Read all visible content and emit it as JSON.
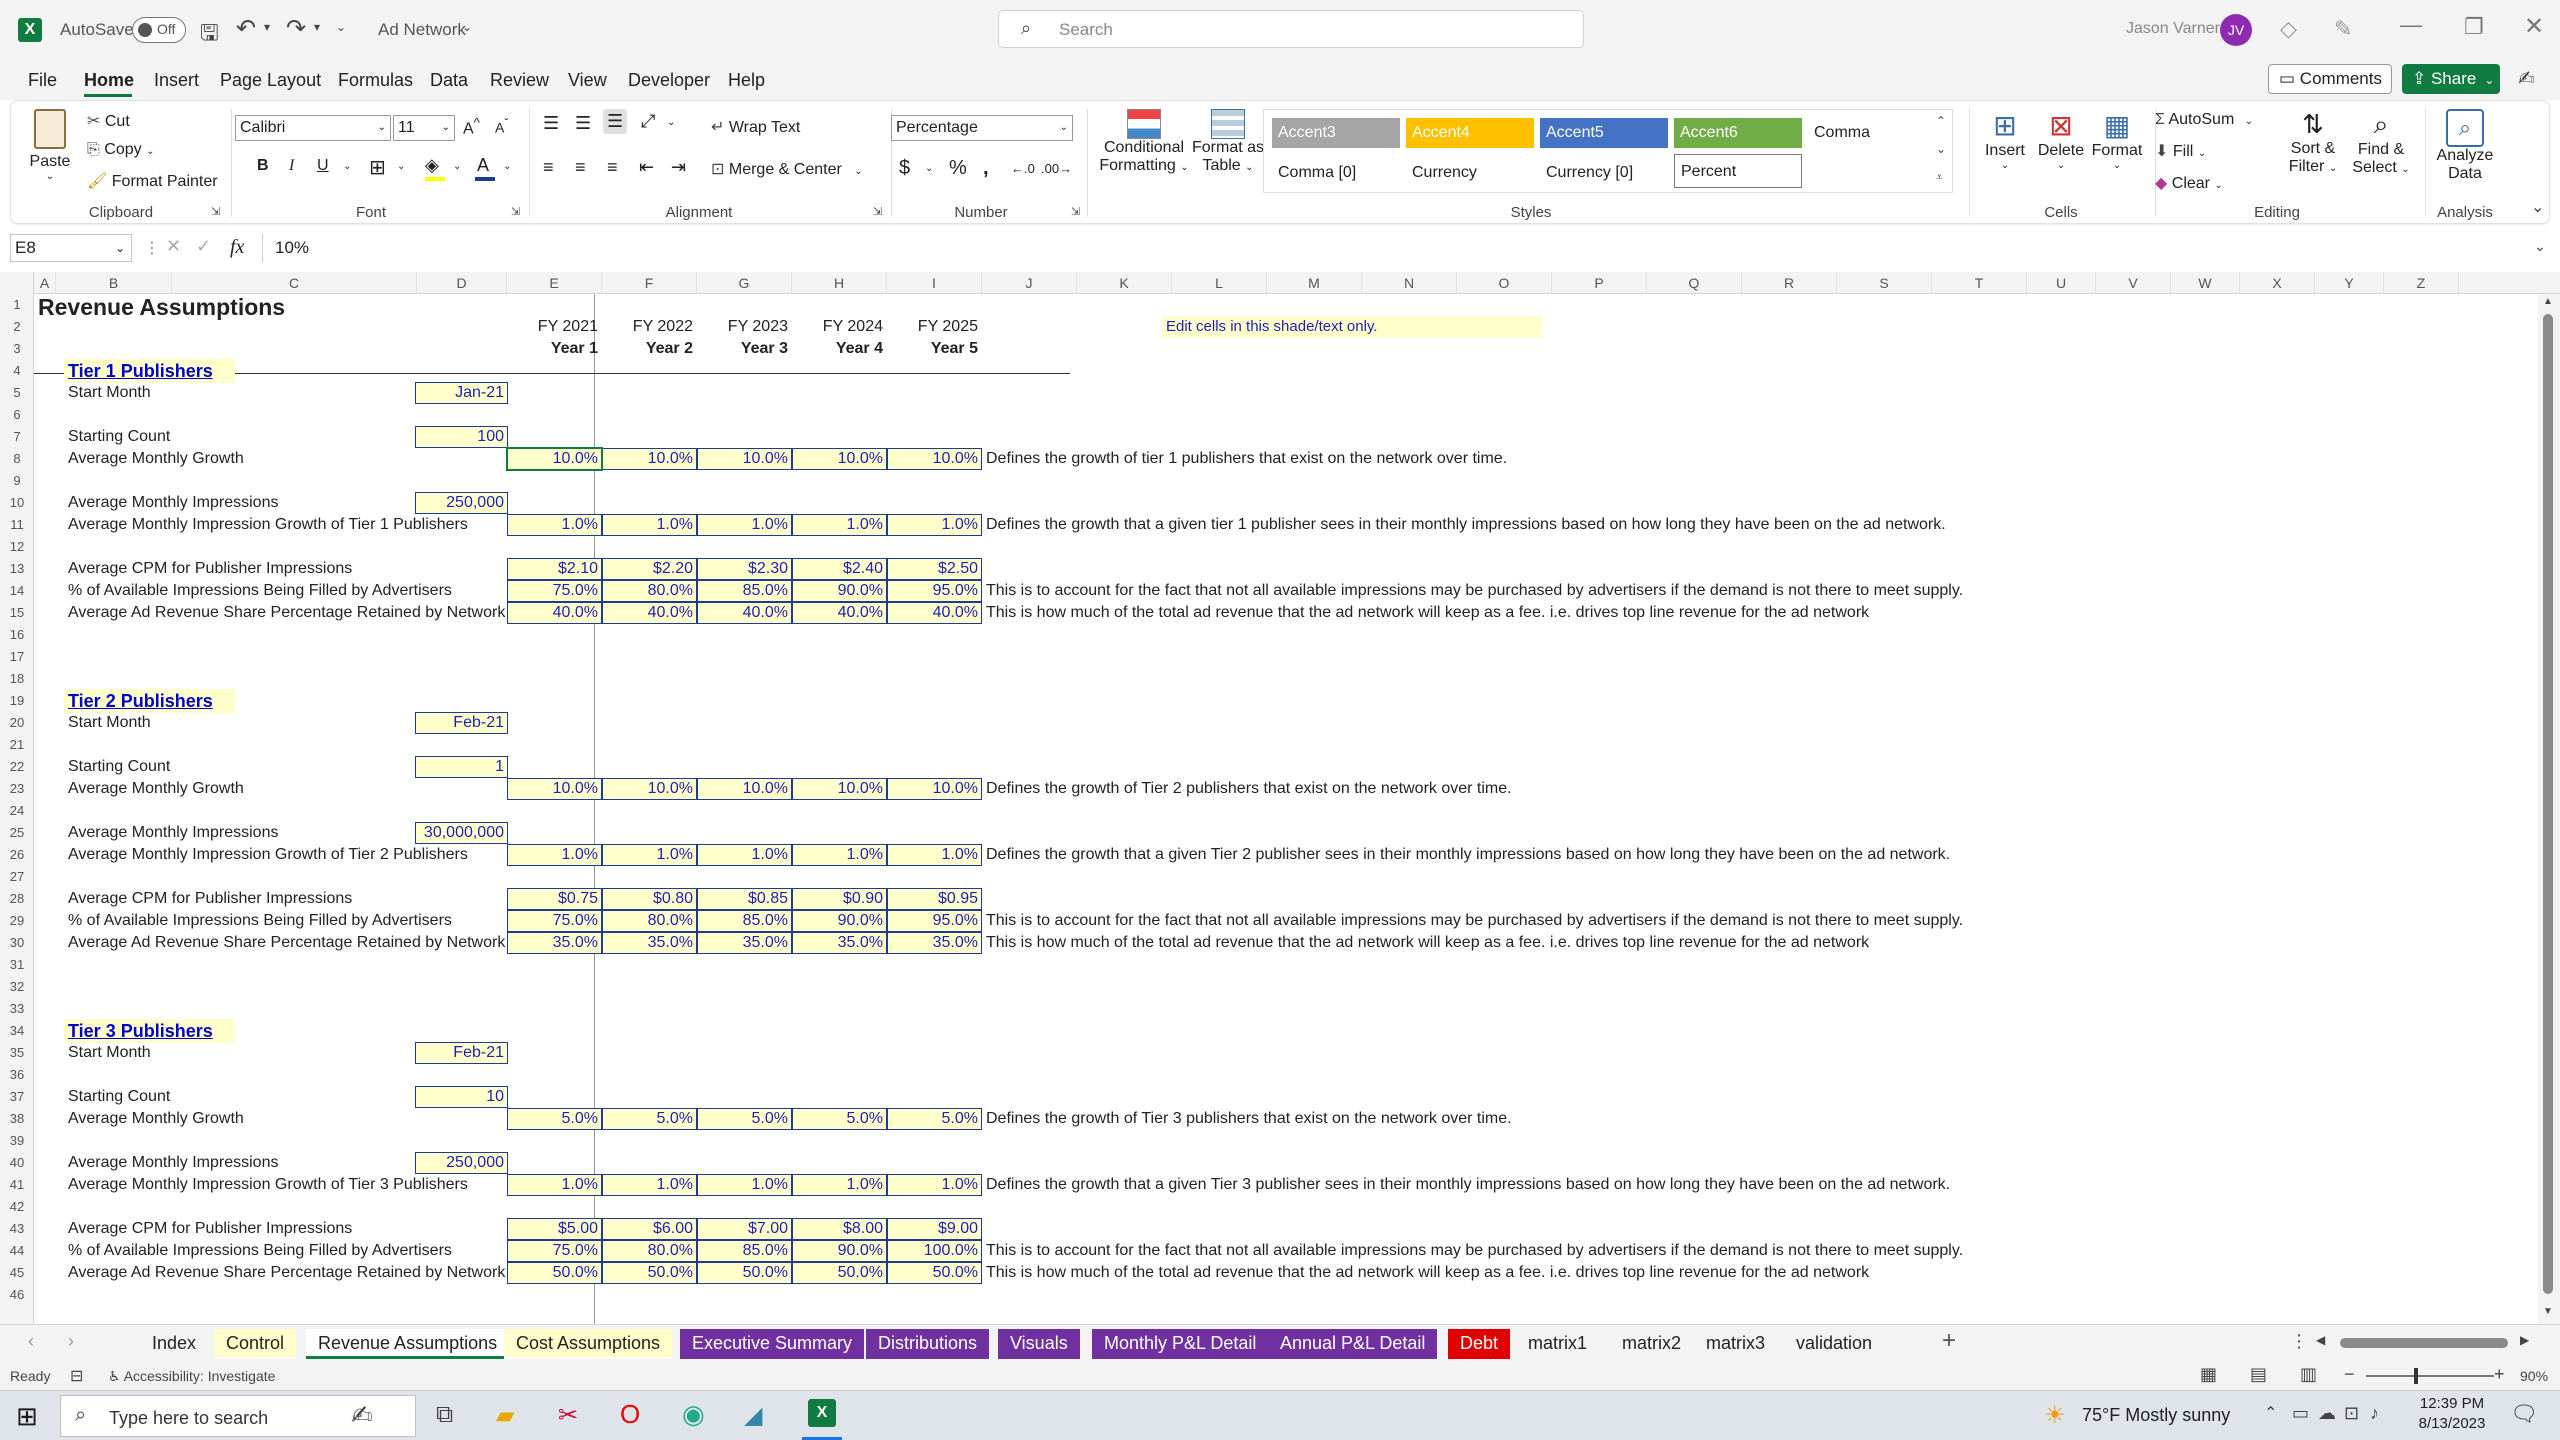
{
  "app": {
    "autosave_label": "AutoSave",
    "autosave_state": "Off",
    "filename": "Ad Network",
    "search_placeholder": "Search",
    "user_name": "Jason Varner",
    "user_initials": "JV"
  },
  "menu": [
    "File",
    "Home",
    "Insert",
    "Page Layout",
    "Formulas",
    "Data",
    "Review",
    "View",
    "Developer",
    "Help"
  ],
  "menu_active": "Home",
  "actions": {
    "comments": "Comments",
    "share": "Share"
  },
  "ribbon": {
    "clipboard": {
      "paste": "Paste",
      "cut": "Cut",
      "copy": "Copy",
      "format_painter": "Format Painter",
      "label": "Clipboard"
    },
    "font": {
      "name": "Calibri",
      "size": "11",
      "label": "Font"
    },
    "alignment": {
      "wrap_text": "Wrap Text",
      "merge_center": "Merge & Center",
      "label": "Alignment"
    },
    "number": {
      "format": "Percentage",
      "label": "Number"
    },
    "styles": {
      "conditional": "Conditional",
      "conditional2": "Formatting",
      "format_as": "Format as",
      "format_as2": "Table",
      "cells": [
        "Accent3",
        "Accent4",
        "Accent5",
        "Accent6",
        "Comma",
        "Comma [0]",
        "Currency",
        "Currency [0]",
        "Percent"
      ],
      "label": "Styles"
    },
    "cells": {
      "insert": "Insert",
      "delete": "Delete",
      "format": "Format",
      "label": "Cells"
    },
    "editing": {
      "autosum": "AutoSum",
      "fill": "Fill",
      "clear": "Clear",
      "sort": "Sort &",
      "sort2": "Filter",
      "find": "Find &",
      "find2": "Select",
      "label": "Editing"
    },
    "analysis": {
      "analyze": "Analyze",
      "analyze2": "Data",
      "label": "Analysis"
    }
  },
  "formula": {
    "namebox": "E8",
    "fx": "fx",
    "value": "10%"
  },
  "columns": [
    "A",
    "B",
    "C",
    "D",
    "E",
    "F",
    "G",
    "H",
    "I",
    "J",
    "K",
    "L",
    "M",
    "N",
    "O",
    "P",
    "Q",
    "R",
    "S",
    "T",
    "U",
    "V",
    "W",
    "X",
    "Y",
    "Z"
  ],
  "sheet": {
    "title": "Revenue Assumptions",
    "fy": [
      "FY 2021",
      "FY 2022",
      "FY 2023",
      "FY 2024",
      "FY 2025"
    ],
    "years": [
      "Year 1",
      "Year 2",
      "Year 3",
      "Year 4",
      "Year 5"
    ],
    "edit_note": "Edit cells in this shade/text only.",
    "labels": {
      "start": "Start Month",
      "count": "Starting Count",
      "growth": "Average Monthly Growth",
      "impr": "Average Monthly Impressions",
      "cpm": "Average CPM for Publisher Impressions",
      "filled": "% of Available Impressions Being Filled by Advertisers",
      "share": "Average Ad Revenue Share Percentage Retained by Network (fee rev.)"
    },
    "notes": {
      "fill": "This is to account for the fact that not all available impressions may be purchased by advertisers if the demand is not there to meet supply.",
      "share": "This is how much of the total ad revenue that the ad network will keep as a fee. i.e. drives top line revenue for the ad network"
    },
    "tiers": [
      {
        "header": "Tier 1 Publishers",
        "start": "Jan-21",
        "count": "100",
        "growth": [
          "10.0%",
          "10.0%",
          "10.0%",
          "10.0%",
          "10.0%"
        ],
        "growth_note": "Defines the growth of tier 1 publishers  that exist on the network over time.",
        "impr": "250,000",
        "impr_label": "Average Monthly Impression Growth of Tier 1 Publishers",
        "impr_growth": [
          "1.0%",
          "1.0%",
          "1.0%",
          "1.0%",
          "1.0%"
        ],
        "impr_note": "Defines the growth that a given tier 1 publisher sees in their monthly impressions based on how long they have been on the ad network.",
        "cpm": [
          "$2.10",
          "$2.20",
          "$2.30",
          "$2.40",
          "$2.50"
        ],
        "filled": [
          "75.0%",
          "80.0%",
          "85.0%",
          "90.0%",
          "95.0%"
        ],
        "share": [
          "40.0%",
          "40.0%",
          "40.0%",
          "40.0%",
          "40.0%"
        ]
      },
      {
        "header": "Tier 2 Publishers",
        "start": "Feb-21",
        "count": "1",
        "growth": [
          "10.0%",
          "10.0%",
          "10.0%",
          "10.0%",
          "10.0%"
        ],
        "growth_note": "Defines the growth of Tier 2 publishers  that exist on the network over time.",
        "impr": "30,000,000",
        "impr_label": "Average Monthly Impression Growth of Tier 2 Publishers",
        "impr_growth": [
          "1.0%",
          "1.0%",
          "1.0%",
          "1.0%",
          "1.0%"
        ],
        "impr_note": "Defines the growth that a given Tier 2 publisher sees in their monthly impressions based on how long they have been on the ad network.",
        "cpm": [
          "$0.75",
          "$0.80",
          "$0.85",
          "$0.90",
          "$0.95"
        ],
        "filled": [
          "75.0%",
          "80.0%",
          "85.0%",
          "90.0%",
          "95.0%"
        ],
        "share": [
          "35.0%",
          "35.0%",
          "35.0%",
          "35.0%",
          "35.0%"
        ]
      },
      {
        "header": "Tier 3 Publishers",
        "start": "Feb-21",
        "count": "10",
        "growth": [
          "5.0%",
          "5.0%",
          "5.0%",
          "5.0%",
          "5.0%"
        ],
        "growth_note": "Defines the growth of Tier 3 publishers  that exist on the network over time.",
        "impr": "250,000",
        "impr_label": "Average Monthly Impression Growth of Tier 3 Publishers",
        "impr_growth": [
          "1.0%",
          "1.0%",
          "1.0%",
          "1.0%",
          "1.0%"
        ],
        "impr_note": "Defines the growth that a given Tier 3 publisher sees in their monthly impressions based on how long they have been on the ad network.",
        "cpm": [
          "$5.00",
          "$6.00",
          "$7.00",
          "$8.00",
          "$9.00"
        ],
        "filled": [
          "75.0%",
          "80.0%",
          "85.0%",
          "90.0%",
          "100.0%"
        ],
        "share": [
          "50.0%",
          "50.0%",
          "50.0%",
          "50.0%",
          "50.0%"
        ]
      }
    ]
  },
  "tabs": [
    {
      "label": "Index",
      "style": "plain"
    },
    {
      "label": "Control",
      "style": "yellow"
    },
    {
      "label": "Revenue Assumptions",
      "style": "active"
    },
    {
      "label": "Cost Assumptions",
      "style": "yellow"
    },
    {
      "label": "Executive Summary",
      "style": "purple"
    },
    {
      "label": "Distributions",
      "style": "purple"
    },
    {
      "label": "Visuals",
      "style": "purple"
    },
    {
      "label": "Monthly P&L Detail",
      "style": "purple"
    },
    {
      "label": "Annual P&L Detail",
      "style": "purple"
    },
    {
      "label": "Debt",
      "style": "red"
    },
    {
      "label": "matrix1",
      "style": "plain"
    },
    {
      "label": "matrix2",
      "style": "plain"
    },
    {
      "label": "matrix3",
      "style": "plain"
    },
    {
      "label": "validation",
      "style": "plain"
    }
  ],
  "status": {
    "ready": "Ready",
    "accessibility": "Accessibility: Investigate",
    "zoom": "90%"
  },
  "taskbar": {
    "search_placeholder": "Type here to search",
    "weather": "75°F  Mostly sunny",
    "time": "12:39 PM",
    "date": "8/13/2023"
  }
}
